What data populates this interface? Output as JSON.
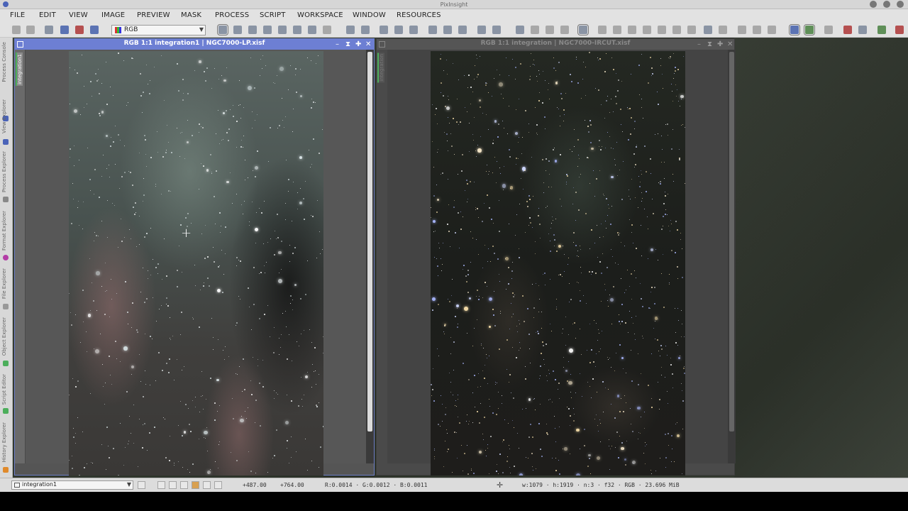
{
  "app": {
    "title": "PixInsight"
  },
  "menu": [
    "FILE",
    "EDIT",
    "VIEW",
    "IMAGE",
    "PREVIEW",
    "MASK",
    "PROCESS",
    "SCRIPT",
    "WORKSPACE",
    "WINDOW",
    "RESOURCES"
  ],
  "toolbar": {
    "channel_combo": "RGB"
  },
  "side_panel": {
    "tabs": [
      "Process Console",
      "View Explorer",
      "Process Explorer",
      "Format Explorer",
      "File Explorer",
      "Object Explorer",
      "Script Editor",
      "History Explorer"
    ]
  },
  "windows": [
    {
      "title": "RGB 1:1 integration1 | NGC7000-LP.xisf",
      "view_tab": "integration1",
      "active": true
    },
    {
      "title": "RGB 1:1 integration | NGC7000-IRCUT.xisf",
      "view_tab": "integration",
      "active": false
    }
  ],
  "status": {
    "view": "integration1",
    "x": "+487.00",
    "y": "+764.00",
    "pixel": "R:0.0014 · G:0.0012 · B:0.0011",
    "info": "w:1079 · h:1919 · n:3 · f32 · RGB · 23.696 MiB"
  },
  "colors": {
    "active_window": "#6d7fd3",
    "accent_green": "#4cae5b"
  }
}
